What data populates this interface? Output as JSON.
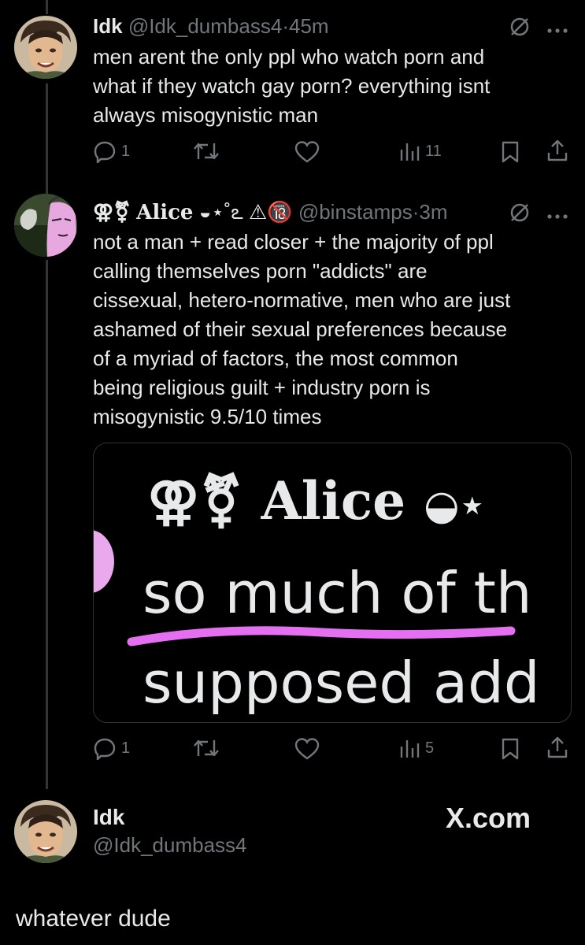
{
  "colors": {
    "background": "#000000",
    "text": "#e7e9ea",
    "muted": "#71767b",
    "underline": "#e46ff0"
  },
  "tweet1": {
    "name": "Idk",
    "handle": "@Idk_dumbass4",
    "sep": "·",
    "time": "45m",
    "text": "men arent the only ppl who watch porn and\nwhat if they watch gay porn? everything isnt\nalways misogynistic man",
    "replies": "1",
    "views": "11"
  },
  "tweet2": {
    "name_symbols": "⚢⚧",
    "name": "Alice",
    "name_emojis": "◒⋆˚ఽ ⚠🔞",
    "handle": "@binstamps",
    "sep": "·",
    "time": "3m",
    "text": "not a man + read closer + the majority of ppl\ncalling themselves porn \"addicts\" are\ncissexual, hetero-normative, men who are just\nashamed of their sexual preferences because\nof a myriad of factors, the most common\nbeing religious guilt + industry porn is\nmisogynistic 9.5/10 times",
    "replies": "1",
    "views": "5",
    "media": {
      "name_symbols": "⚢⚧",
      "name": "Alice",
      "name_extra": "◒⋆",
      "line1": "so much of th",
      "line2": "supposed add"
    }
  },
  "profile": {
    "name": "Idk",
    "handle": "@Idk_dumbass4",
    "site": "X.com"
  },
  "caption": "whatever dude"
}
